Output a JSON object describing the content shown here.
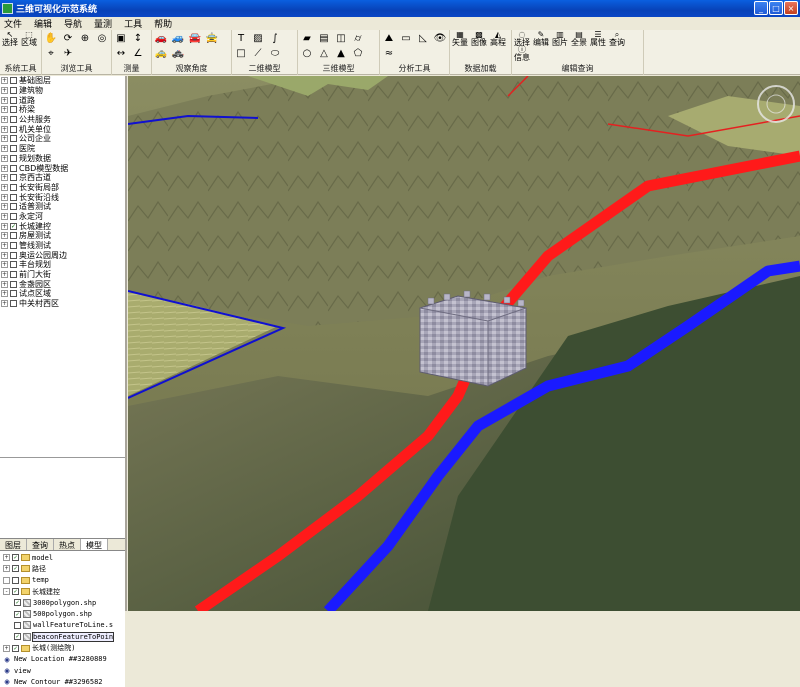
{
  "window": {
    "title": "三维可视化示范系统",
    "min_label": "_",
    "max_label": "□",
    "close_label": "×"
  },
  "menu": {
    "items": [
      "文件",
      "编辑",
      "导航",
      "量测",
      "工具",
      "帮助"
    ]
  },
  "toolbar": {
    "groups": [
      {
        "label": "系统工具",
        "tools": [
          {
            "icon": "select-arrow-icon",
            "text": "选择"
          },
          {
            "icon": "region-icon",
            "text": "区域"
          }
        ]
      },
      {
        "label": "浏览工具",
        "tools": [
          {
            "icon": "pan-hand-icon"
          },
          {
            "icon": "rotate-icon"
          },
          {
            "icon": "zoom-icon"
          },
          {
            "icon": "globe-icon"
          },
          {
            "icon": "target-icon"
          },
          {
            "icon": "fly-icon"
          }
        ]
      },
      {
        "label": "测量",
        "tools": [
          {
            "icon": "measure-area-icon"
          },
          {
            "icon": "measure-height-icon"
          },
          {
            "icon": "measure-distance-icon"
          },
          {
            "icon": "measure-angle-icon"
          }
        ]
      },
      {
        "label": "观察角度",
        "tools": [
          {
            "icon": "car-front-icon"
          },
          {
            "icon": "car-side-icon"
          },
          {
            "icon": "car-back-icon"
          },
          {
            "icon": "car-top-icon"
          },
          {
            "icon": "car-left-icon"
          },
          {
            "icon": "car-right-icon"
          }
        ]
      },
      {
        "label": "二维模型",
        "tools": [
          {
            "icon": "text-icon"
          },
          {
            "icon": "image-icon"
          },
          {
            "icon": "curve-icon"
          },
          {
            "icon": "rectangle-icon"
          },
          {
            "icon": "polyline-icon"
          },
          {
            "icon": "ellipse-icon"
          }
        ]
      },
      {
        "label": "三维模型",
        "tools": [
          {
            "icon": "plane-model-icon"
          },
          {
            "icon": "box-model-icon"
          },
          {
            "icon": "cube-icon"
          },
          {
            "icon": "cylinder-icon"
          },
          {
            "icon": "circle-icon"
          },
          {
            "icon": "pyramid-icon"
          },
          {
            "icon": "cone-icon"
          },
          {
            "icon": "polygon-icon"
          }
        ]
      },
      {
        "label": "分析工具",
        "tools": [
          {
            "icon": "terrain-icon"
          },
          {
            "icon": "profile-icon"
          },
          {
            "icon": "slope-icon"
          },
          {
            "icon": "visibility-icon"
          },
          {
            "icon": "flood-icon"
          }
        ]
      },
      {
        "label": "数据加载",
        "tools": [
          {
            "icon": "vector-icon",
            "text": "矢量"
          },
          {
            "icon": "raster-icon",
            "text": "图像"
          },
          {
            "icon": "elevation-icon",
            "text": "高程"
          }
        ]
      },
      {
        "label": "编辑查询",
        "tools": [
          {
            "icon": "select-icon",
            "text": "选择"
          },
          {
            "icon": "edit-icon",
            "text": "编辑"
          },
          {
            "icon": "picture-icon",
            "text": "图片"
          },
          {
            "icon": "panorama-icon",
            "text": "全景"
          },
          {
            "icon": "attribute-icon",
            "text": "属性"
          },
          {
            "icon": "query-icon",
            "text": "查询"
          },
          {
            "icon": "info-icon",
            "text": "信息"
          }
        ]
      }
    ]
  },
  "layer_list": [
    {
      "label": "基础图层",
      "checked": false
    },
    {
      "label": "建筑物",
      "checked": false
    },
    {
      "label": "道路",
      "checked": false
    },
    {
      "label": "桥梁",
      "checked": false
    },
    {
      "label": "公共服务",
      "checked": false
    },
    {
      "label": "机关单位",
      "checked": false
    },
    {
      "label": "公司企业",
      "checked": false
    },
    {
      "label": "医院",
      "checked": false
    },
    {
      "label": "规划数据",
      "checked": false
    },
    {
      "label": "CBD模型数据",
      "checked": false
    },
    {
      "label": "京西古道",
      "checked": false
    },
    {
      "label": "长安街局部",
      "checked": false
    },
    {
      "label": "长安街沿线",
      "checked": false
    },
    {
      "label": "适普测试",
      "checked": false
    },
    {
      "label": "永定河",
      "checked": false
    },
    {
      "label": "长城建控",
      "checked": true
    },
    {
      "label": "房屋测试",
      "checked": false
    },
    {
      "label": "管线测试",
      "checked": false
    },
    {
      "label": "奥运公园周边",
      "checked": false
    },
    {
      "label": "丰台规划",
      "checked": false
    },
    {
      "label": "前门大街",
      "checked": false
    },
    {
      "label": "金盏园区",
      "checked": false
    },
    {
      "label": "试点区域",
      "checked": false
    },
    {
      "label": "中关村西区",
      "checked": false
    }
  ],
  "panel_tabs": [
    "图层",
    "查询",
    "热点",
    "模型"
  ],
  "active_tab": "模型",
  "model_tree": [
    {
      "kind": "folder",
      "label": "model",
      "indent": 0,
      "expand": "+",
      "checked": true
    },
    {
      "kind": "folder",
      "label": "路径",
      "indent": 0,
      "expand": "+",
      "checked": true
    },
    {
      "kind": "folder",
      "label": "temp",
      "indent": 0,
      "expand": "",
      "checked": false
    },
    {
      "kind": "folder",
      "label": "长城建控",
      "indent": 0,
      "expand": "-",
      "checked": true
    },
    {
      "kind": "shp",
      "label": "3000polygon.shp",
      "indent": 1,
      "checked": true
    },
    {
      "kind": "shp",
      "label": "500polygon.shp",
      "indent": 1,
      "checked": true
    },
    {
      "kind": "shp",
      "label": "wallFeatureToLine.s",
      "indent": 1,
      "checked": false
    },
    {
      "kind": "shp",
      "label": "beaconFeatureToPoin",
      "indent": 1,
      "checked": true,
      "highlight": true
    },
    {
      "kind": "folder",
      "label": "长城(测绘院)",
      "indent": 0,
      "expand": "+",
      "checked": true
    },
    {
      "kind": "view",
      "label": "New Location ##3280889",
      "indent": 0
    },
    {
      "kind": "view",
      "label": "view",
      "indent": 0
    },
    {
      "kind": "view",
      "label": "New Contour ##3296582",
      "indent": 0
    }
  ],
  "colors": {
    "title_blue": "#0a46c4",
    "buffer_red": "#ff1a1a",
    "buffer_blue": "#1a1aff",
    "boundary_blue": "#1010d0"
  }
}
